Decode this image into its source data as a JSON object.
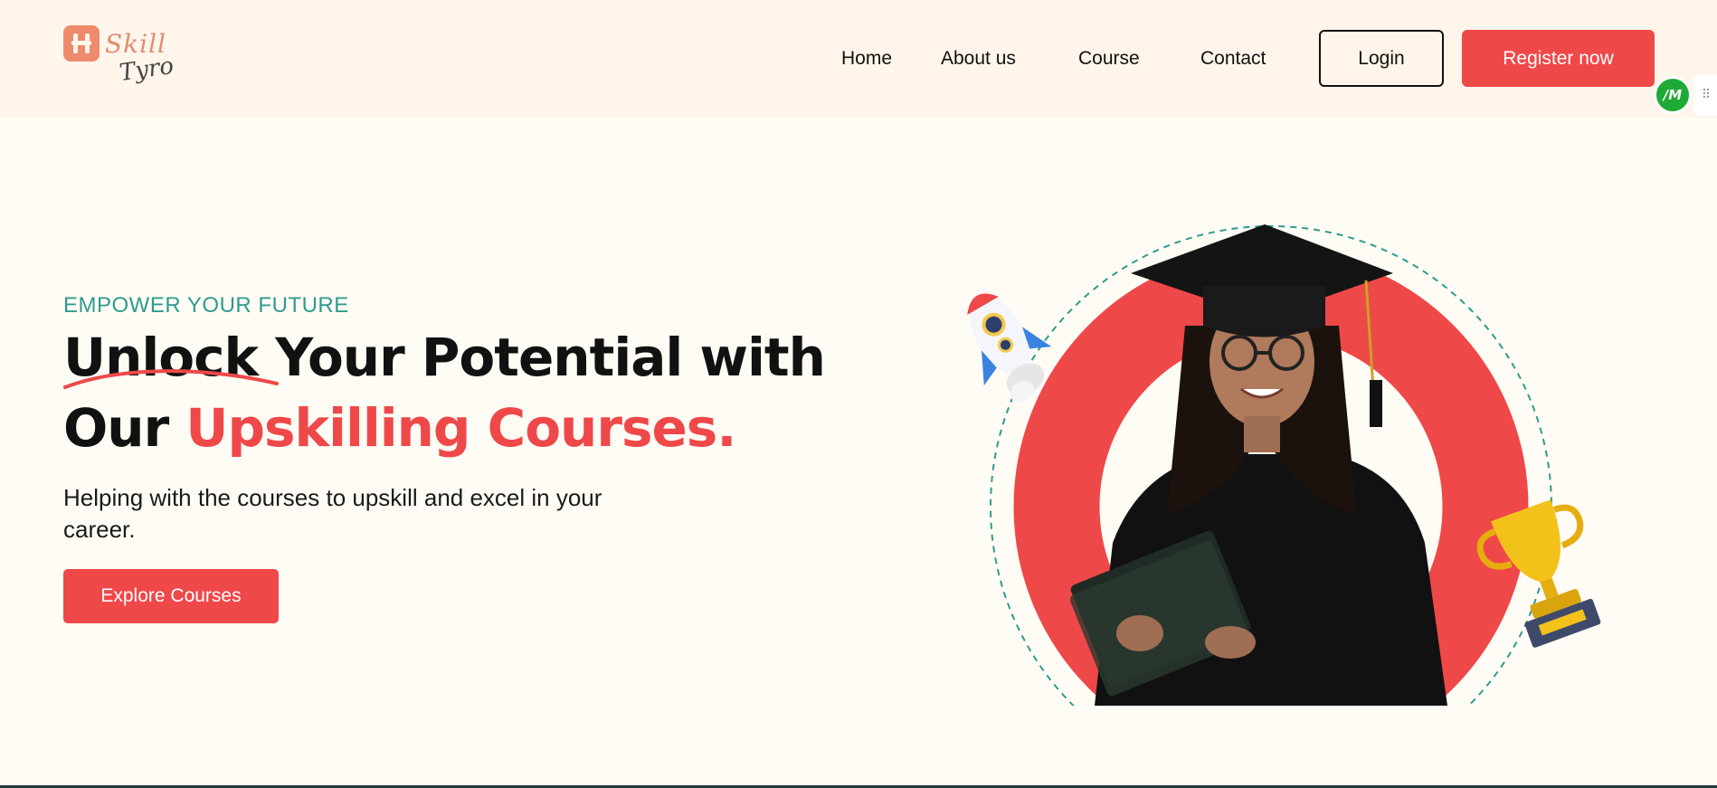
{
  "logo": {
    "brand_top": "Skill",
    "brand_bottom": "Tyro"
  },
  "nav": {
    "items": [
      {
        "label": "Home"
      },
      {
        "label": "About us"
      },
      {
        "label": "Course"
      },
      {
        "label": "Contact"
      }
    ],
    "login_label": "Login",
    "register_label": "Register now"
  },
  "extension": {
    "badge_text": "/M",
    "grip": "⠿"
  },
  "hero": {
    "eyebrow": "EMPOWER YOUR FUTURE",
    "headline_unlock": "Unlock",
    "headline_rest1": " Your Potential with",
    "headline_line2_plain": "Our ",
    "headline_line2_accent": "Upskilling Courses.",
    "subtext": "Helping with the courses to upskill and excel in your career.",
    "cta_label": "Explore Courses"
  },
  "colors": {
    "accent": "#ef4849",
    "teal": "#2f9c8c",
    "header_bg": "#fff5ea",
    "page_bg": "#fffcf5",
    "extension_green": "#1faa36"
  },
  "illustration": {
    "subject": "graduate-student-in-cap-and-gown",
    "decorations": [
      "rocket-icon",
      "trophy-icon",
      "dashed-circle",
      "red-ring"
    ]
  }
}
